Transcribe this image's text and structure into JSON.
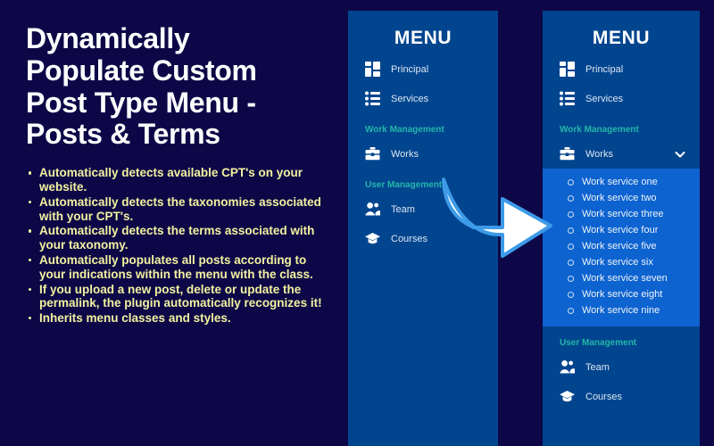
{
  "promo": {
    "title": "Dynamically\nPopulate Custom\nPost Type Menu -\nPosts & Terms",
    "bullets": [
      "Automatically detects available CPT's on your website.",
      "Automatically detects the taxonomies associated with your CPT's.",
      "Automatically detects the terms associated with your taxonomy.",
      "Automatically populates all posts according to your indications within the menu with the class.",
      "If you upload a new post, delete or update the permalink, the plugin automatically recognizes it!",
      "Inherits menu classes and styles."
    ]
  },
  "menu_before": {
    "heading": "MENU",
    "items": [
      {
        "label": "Principal",
        "icon": "dashboard-icon"
      },
      {
        "label": "Services",
        "icon": "list-icon"
      }
    ],
    "group_work": "Work Management",
    "works": {
      "label": "Works",
      "icon": "briefcase-icon"
    },
    "group_user": "User Management",
    "user_items": [
      {
        "label": "Team",
        "icon": "people-icon"
      },
      {
        "label": "Courses",
        "icon": "graduation-cap-icon"
      }
    ]
  },
  "menu_after": {
    "heading": "MENU",
    "items": [
      {
        "label": "Principal",
        "icon": "dashboard-icon"
      },
      {
        "label": "Services",
        "icon": "list-icon"
      }
    ],
    "group_work": "Work Management",
    "works": {
      "label": "Works",
      "icon": "briefcase-icon",
      "expand_icon": "chevron-down-icon"
    },
    "submenu": [
      "Work service one",
      "Work service two",
      "Work service three",
      "Work service four",
      "Work service five",
      "Work service six",
      "Work service seven",
      "Work service eight",
      "Work service nine"
    ],
    "group_user": "User Management",
    "user_items": [
      {
        "label": "Team",
        "icon": "people-icon"
      },
      {
        "label": "Courses",
        "icon": "graduation-cap-icon"
      }
    ]
  },
  "arrow": {
    "icon": "right-arrow-icon"
  },
  "colors": {
    "background": "#0d0747",
    "panel": "#02458f",
    "submenu_highlight": "#0d63cf",
    "group_title": "#23b6a8",
    "bullet_text": "#f2f2a0",
    "arrow_outline": "#3d9ae8"
  }
}
